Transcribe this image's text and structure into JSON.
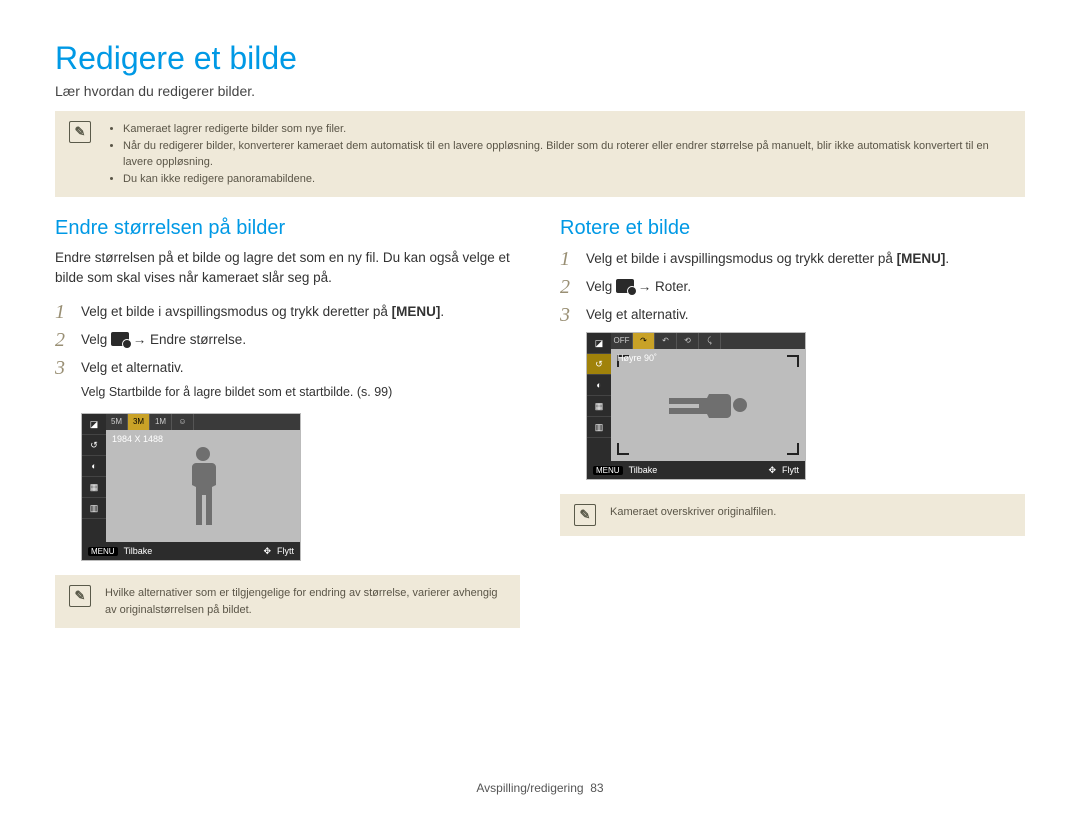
{
  "title": "Redigere et bilde",
  "subtitle": "Lær hvordan du redigerer bilder.",
  "top_info": [
    "Kameraet lagrer redigerte bilder som nye filer.",
    "Når du redigerer bilder, konverterer kameraet dem automatisk til en lavere oppløsning. Bilder som du roterer eller endrer størrelse på manuelt, blir ikke automatisk konvertert til en lavere oppløsning.",
    "Du kan ikke redigere panoramabildene."
  ],
  "left": {
    "heading": "Endre størrelsen på bilder",
    "desc": "Endre størrelsen på et bilde og lagre det som en ny fil. Du kan også velge et bilde som skal vises når kameraet slår seg på.",
    "step1_a": "Velg et bilde i avspillingsmodus og trykk deretter på ",
    "step1_b": "[MENU]",
    "step1_c": ".",
    "step2_a": "Velg ",
    "step2_b": " → Endre størrelse",
    "step2_c": ".",
    "step3": "Velg et alternativ.",
    "step3_note_a": "Velg ",
    "step3_note_b": "Startbilde",
    "step3_note_c": " for å lagre bildet som et startbilde. (s. 99)",
    "ss_res": "1984 X 1488",
    "ss_back": "Tilbake",
    "ss_move": "Flytt",
    "info": "Hvilke alternativer som er tilgjengelige for endring av størrelse, varierer avhengig av originalstørrelsen på bildet."
  },
  "right": {
    "heading": "Rotere et bilde",
    "step1_a": "Velg et bilde i avspillingsmodus og trykk deretter på ",
    "step1_b": "[MENU]",
    "step1_c": ".",
    "step2_a": "Velg ",
    "step2_b": " → Roter",
    "step2_c": ".",
    "step3": "Velg et alternativ.",
    "ss_label": "Høyre 90˚",
    "ss_back": "Tilbake",
    "ss_move": "Flytt",
    "info": "Kameraet overskriver originalfilen."
  },
  "footer": {
    "section": "Avspilling/redigering",
    "page": "83"
  },
  "ui": {
    "menu_label": "MENU",
    "nav_icon": "✥",
    "pencil": "✎"
  }
}
